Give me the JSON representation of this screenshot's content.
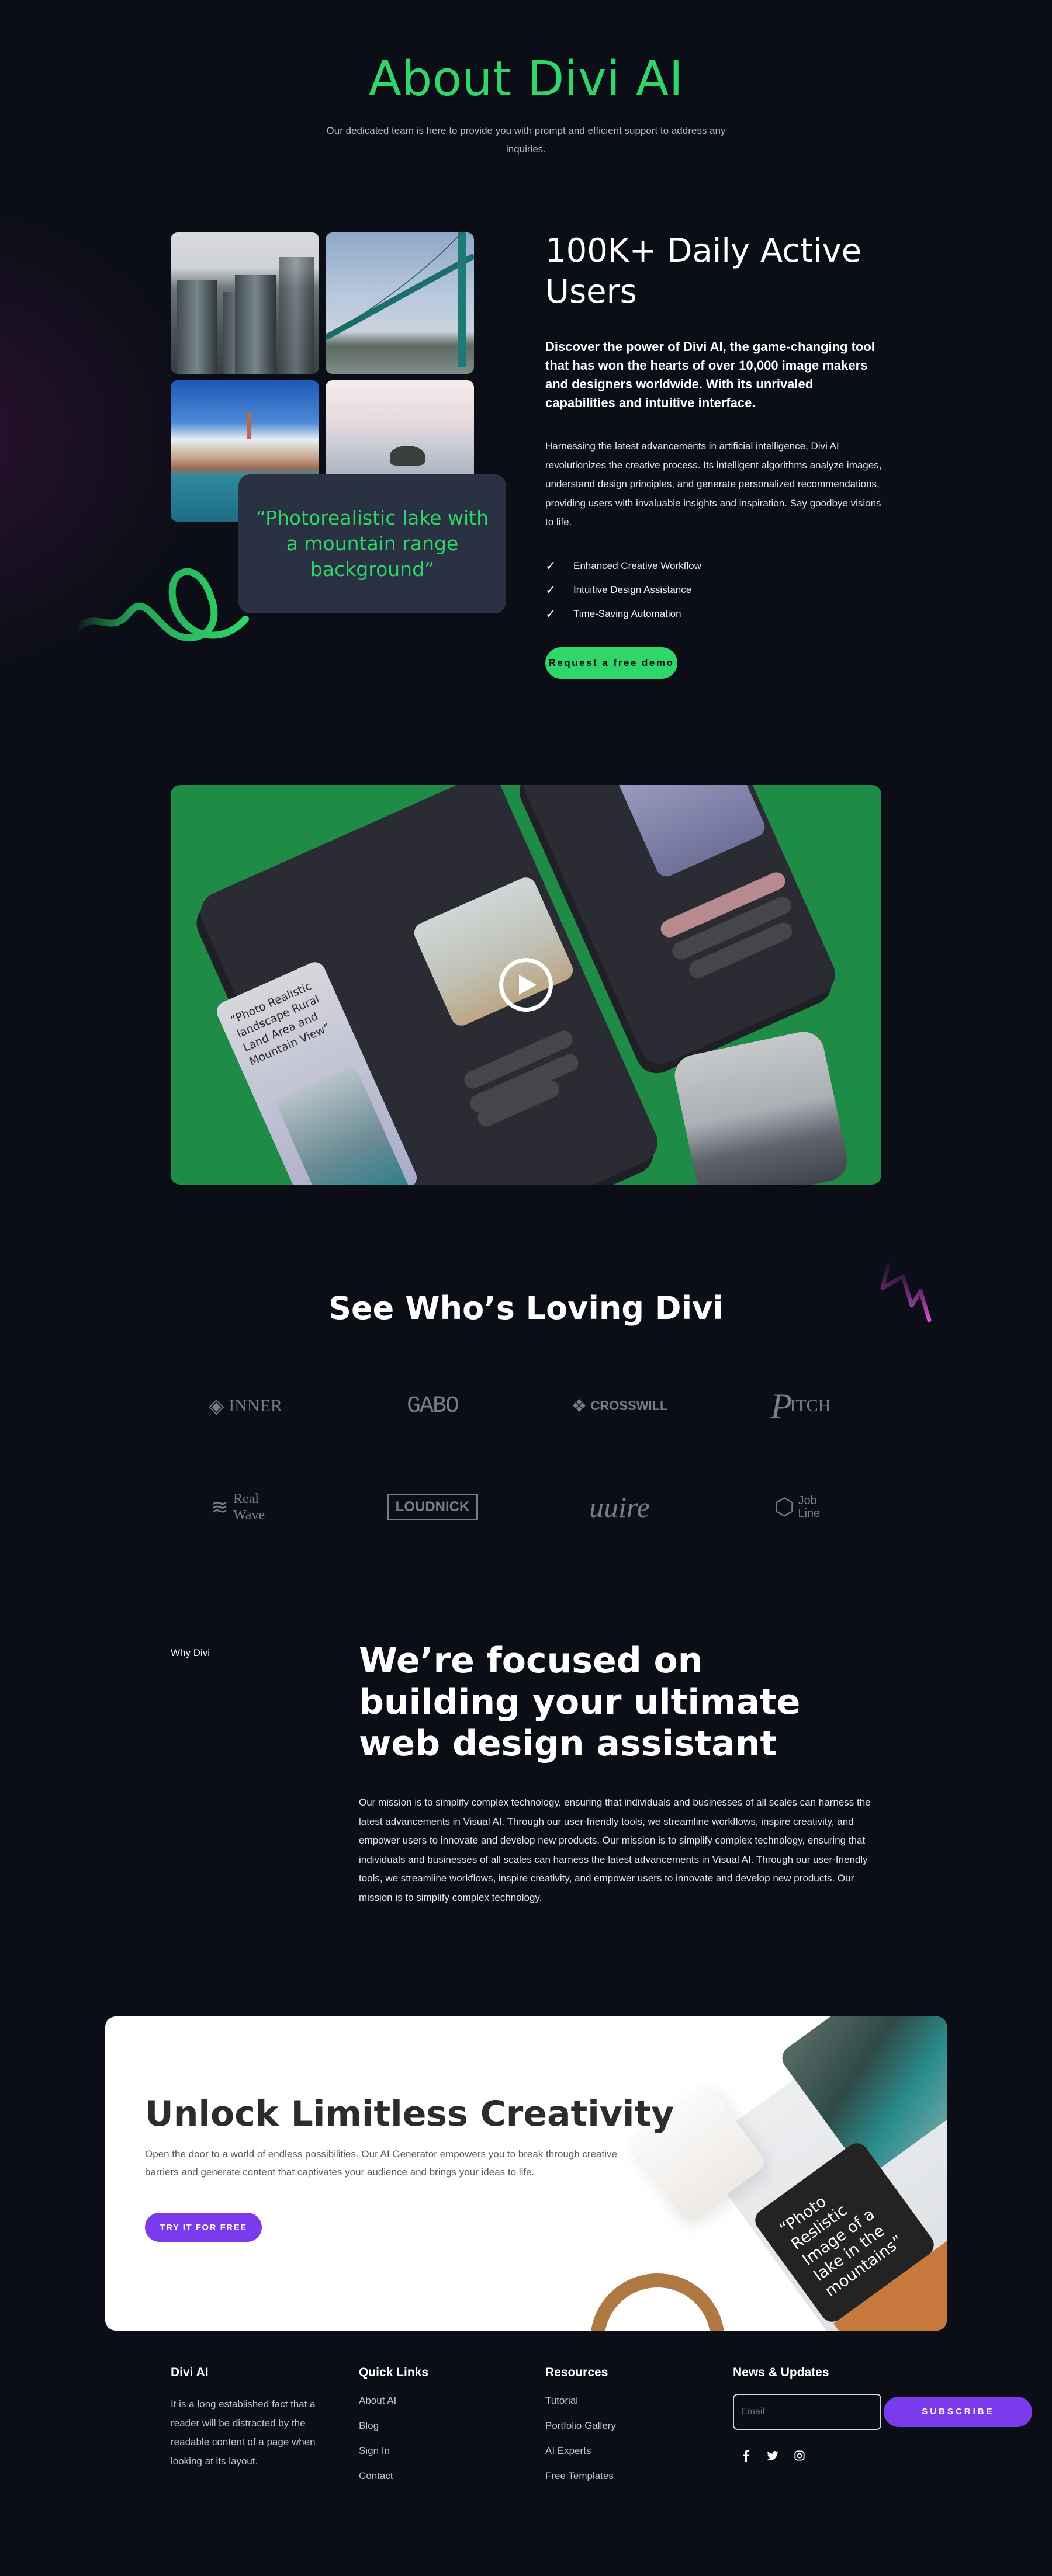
{
  "colors": {
    "background": "#0b0e16",
    "accent_green": "#2fd66a",
    "accent_purple": "#7c3aed",
    "card": "#2a3142",
    "video_bg": "#1e8b47"
  },
  "hero": {
    "title": "About Divi AI",
    "subtitle": "Our dedicated team is here to provide you with prompt and efficient support to address any inquiries."
  },
  "stats": {
    "gallery_images": [
      "city-towers-image",
      "bridge-image",
      "venice-aerial-image",
      "sea-rock-image"
    ],
    "prompt_quote": "“Photorealistic lake with a mountain range background”",
    "title": "100K+ Daily Active Users",
    "lead": "Discover the power of Divi AI, the game-changing tool that has won the hearts of over 10,000 image makers and designers worldwide. With its unrivaled capabilities and intuitive interface.",
    "body": "Harnessing the latest advancements in artificial intelligence, Divi AI revolutionizes the creative process. Its intelligent algorithms analyze images, understand design principles, and generate personalized recommendations, providing users with invaluable insights and inspiration. Say goodbye visions to life.",
    "features": [
      {
        "icon": "check-icon",
        "label": "Enhanced Creative Workflow"
      },
      {
        "icon": "check-icon",
        "label": "Intuitive Design Assistance"
      },
      {
        "icon": "check-icon",
        "label": "Time-Saving Automation"
      }
    ],
    "cta_label": "Request a free demo"
  },
  "video": {
    "card_text": "“Photo Realistic landscape Rural Land Area and Mountain View”",
    "play_icon": "play-icon"
  },
  "loving": {
    "title": "See Who’s Loving Divi",
    "logos": [
      "INNER",
      "GABO",
      "CROSSWILL",
      "ITCH",
      "Real Wave",
      "LOUDNICK",
      "uuire",
      "Job Line"
    ]
  },
  "why": {
    "label": "Why Divi",
    "title": "We’re focused on building your ultimate web design assistant",
    "body": "Our mission is to simplify complex technology, ensuring that individuals and businesses of all scales can harness the latest advancements in Visual AI. Through our user-friendly tools, we streamline workflows, inspire creativity, and empower users to innovate and develop new products. Our mission is to simplify complex technology, ensuring that individuals and businesses of all scales can harness the latest advancements in Visual AI. Through our user-friendly tools, we streamline workflows, inspire creativity, and empower users to innovate and develop new products. Our mission is to simplify complex technology."
  },
  "cta": {
    "title": "Unlock Limitless Creativity",
    "body": "Open the door to a world of endless possibilities. Our AI Generator empowers you to break through creative barriers and generate content that captivates your audience and brings your ideas to life.",
    "button": "TRY IT FOR FREE",
    "quote": "“Photo Reslistic Image of a lake in the mountains”"
  },
  "footer": {
    "brand": {
      "title": "Divi AI",
      "text": "It is a long established fact that a reader will be distracted by the readable content of a page when looking at its layout."
    },
    "quick_links": {
      "title": "Quick Links",
      "items": [
        "About AI",
        "Blog",
        "Sign In",
        "Contact"
      ]
    },
    "resources": {
      "title": "Resources",
      "items": [
        "Tutorial",
        "Portfolio Gallery",
        "AI Experts",
        "Free Templates"
      ]
    },
    "news": {
      "title": "News & Updates",
      "email_placeholder": "Email",
      "email_value": "",
      "subscribe": "SUBSCRIBE",
      "socials": [
        "facebook-icon",
        "twitter-icon",
        "instagram-icon"
      ]
    }
  }
}
